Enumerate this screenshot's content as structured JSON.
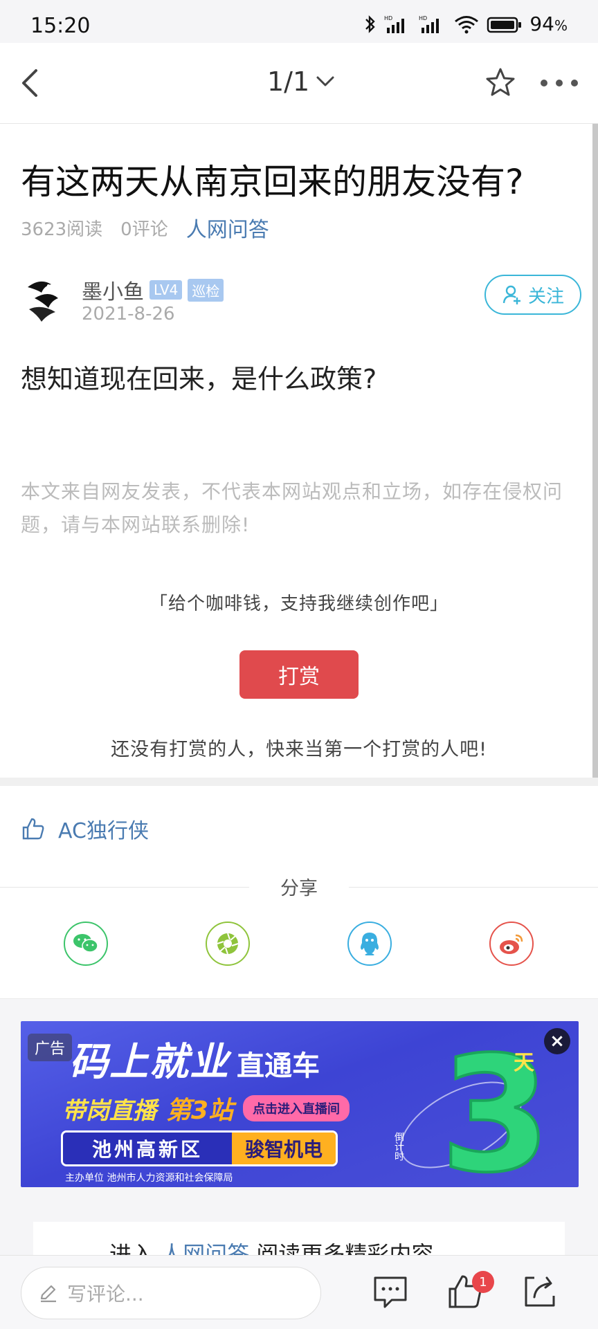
{
  "status_bar": {
    "time": "15:20",
    "battery": "94",
    "battery_unit": "%"
  },
  "header": {
    "page_indicator": "1/1"
  },
  "article": {
    "title": "有这两天从南京回来的朋友没有?",
    "reads": "3623阅读",
    "comments": "0评论",
    "category": "人网问答",
    "author": {
      "name": "墨小鱼",
      "level": "LV4",
      "role_badge": "巡检",
      "date": "2021-8-26"
    },
    "follow_label": "关注",
    "body": "想知道现在回来，是什么政策?",
    "disclaimer": "本文来自网友发表，不代表本网站观点和立场，如存在侵权问题，请与本网站联系删除!",
    "coffee_text": "「给个咖啡钱，支持我继续创作吧」",
    "reward_label": "打赏",
    "no_reward_text": "还没有打赏的人，快来当第一个打赏的人吧!"
  },
  "likes": {
    "users": [
      "AC独行侠"
    ]
  },
  "share": {
    "label": "分享",
    "targets": [
      {
        "name": "wechat",
        "color": "#3cc46a"
      },
      {
        "name": "moments",
        "color": "#8fc43c"
      },
      {
        "name": "qq",
        "color": "#3aaee0"
      },
      {
        "name": "weibo",
        "color": "#e5534b"
      }
    ]
  },
  "ad": {
    "tag": "广告",
    "headline_big": "码上就业",
    "headline_small": "直通车",
    "row_a": "带岗直播",
    "row_b": "第3站",
    "row_c": "点击进入直播间",
    "box_left": "池州高新区",
    "box_right": "骏智机电",
    "footer": "主办单位 池州市人力资源和社会保障局",
    "big_number": "3",
    "day_char": "天",
    "countdown": "倒计时"
  },
  "more": {
    "prefix": "进入",
    "link": "人网问答",
    "suffix": "阅读更多精彩内容"
  },
  "bottom_bar": {
    "comment_placeholder": "写评论...",
    "like_count": "1"
  },
  "colors": {
    "accent_blue": "#4a7bb1",
    "follow_cyan": "#3ab6d8",
    "reward_red": "#e04a4d"
  }
}
